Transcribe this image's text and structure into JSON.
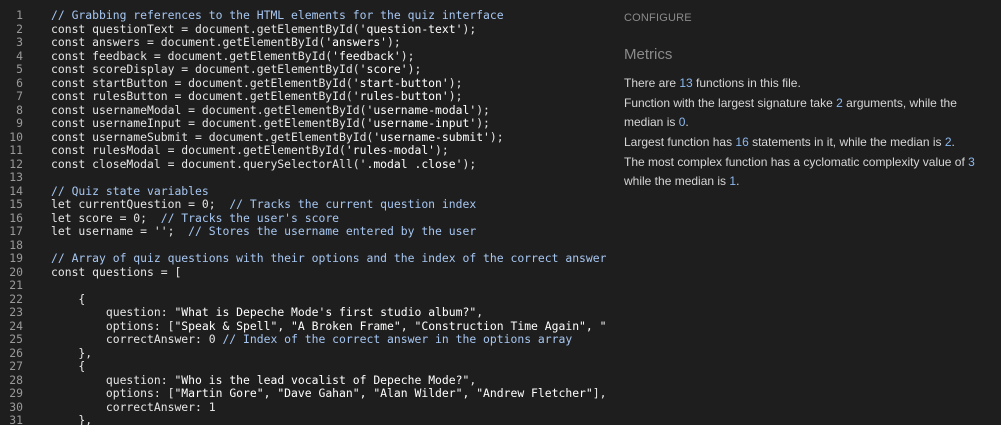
{
  "editor": {
    "lines": [
      {
        "n": "1",
        "tokens": [
          {
            "t": "// Grabbing references to the HTML elements for the quiz interface",
            "c": "cm"
          }
        ]
      },
      {
        "n": "2",
        "tokens": [
          {
            "t": "const questionText = document.getElementById("
          },
          {
            "t": "'question-text'",
            "c": "str"
          },
          {
            "t": ");"
          }
        ]
      },
      {
        "n": "3",
        "tokens": [
          {
            "t": "const answers = document.getElementById("
          },
          {
            "t": "'answers'",
            "c": "str"
          },
          {
            "t": ");"
          }
        ]
      },
      {
        "n": "4",
        "tokens": [
          {
            "t": "const feedback = document.getElementById("
          },
          {
            "t": "'feedback'",
            "c": "str"
          },
          {
            "t": ");"
          }
        ]
      },
      {
        "n": "5",
        "tokens": [
          {
            "t": "const scoreDisplay = document.getElementById("
          },
          {
            "t": "'score'",
            "c": "str"
          },
          {
            "t": ");"
          }
        ]
      },
      {
        "n": "6",
        "tokens": [
          {
            "t": "const startButton = document.getElementById("
          },
          {
            "t": "'start-button'",
            "c": "str"
          },
          {
            "t": ");"
          }
        ]
      },
      {
        "n": "7",
        "tokens": [
          {
            "t": "const rulesButton = document.getElementById("
          },
          {
            "t": "'rules-button'",
            "c": "str"
          },
          {
            "t": ");"
          }
        ]
      },
      {
        "n": "8",
        "tokens": [
          {
            "t": "const usernameModal = document.getElementById("
          },
          {
            "t": "'username-modal'",
            "c": "str"
          },
          {
            "t": ");"
          }
        ]
      },
      {
        "n": "9",
        "tokens": [
          {
            "t": "const usernameInput = document.getElementById("
          },
          {
            "t": "'username-input'",
            "c": "str"
          },
          {
            "t": ");"
          }
        ]
      },
      {
        "n": "10",
        "tokens": [
          {
            "t": "const usernameSubmit = document.getElementById("
          },
          {
            "t": "'username-submit'",
            "c": "str"
          },
          {
            "t": ");"
          }
        ]
      },
      {
        "n": "11",
        "tokens": [
          {
            "t": "const rulesModal = document.getElementById("
          },
          {
            "t": "'rules-modal'",
            "c": "str"
          },
          {
            "t": ");"
          }
        ]
      },
      {
        "n": "12",
        "tokens": [
          {
            "t": "const closeModal = document.querySelectorAll("
          },
          {
            "t": "'.modal .close'",
            "c": "str"
          },
          {
            "t": ");"
          }
        ]
      },
      {
        "n": "13",
        "tokens": []
      },
      {
        "n": "14",
        "tokens": [
          {
            "t": "// Quiz state variables",
            "c": "cm"
          }
        ]
      },
      {
        "n": "15",
        "tokens": [
          {
            "t": "let currentQuestion = 0;  "
          },
          {
            "t": "// Tracks the current question index",
            "c": "cm"
          }
        ]
      },
      {
        "n": "16",
        "tokens": [
          {
            "t": "let score = 0;  "
          },
          {
            "t": "// Tracks the user's score",
            "c": "cm"
          }
        ]
      },
      {
        "n": "17",
        "tokens": [
          {
            "t": "let username = '';  "
          },
          {
            "t": "// Stores the username entered by the user",
            "c": "cm"
          }
        ]
      },
      {
        "n": "18",
        "tokens": []
      },
      {
        "n": "19",
        "tokens": [
          {
            "t": "// Array of quiz questions with their options and the index of the correct answer",
            "c": "cm"
          }
        ]
      },
      {
        "n": "20",
        "tokens": [
          {
            "t": "const questions = ["
          }
        ]
      },
      {
        "n": "21",
        "tokens": []
      },
      {
        "n": "22",
        "tokens": [
          {
            "t": "    {"
          }
        ]
      },
      {
        "n": "23",
        "tokens": [
          {
            "t": "        question: "
          },
          {
            "t": "\"What is Depeche Mode's first studio album?\"",
            "c": "str"
          },
          {
            "t": ","
          }
        ]
      },
      {
        "n": "24",
        "tokens": [
          {
            "t": "        options: ["
          },
          {
            "t": "\"Speak & Spell\", \"A Broken Frame\", \"Construction Time Again\", \"B",
            "c": "str"
          }
        ]
      },
      {
        "n": "25",
        "tokens": [
          {
            "t": "        correctAnswer: 0 "
          },
          {
            "t": "// Index of the correct answer in the options array",
            "c": "cm"
          }
        ]
      },
      {
        "n": "26",
        "tokens": [
          {
            "t": "    },"
          }
        ]
      },
      {
        "n": "27",
        "tokens": [
          {
            "t": "    {"
          }
        ]
      },
      {
        "n": "28",
        "tokens": [
          {
            "t": "        question: "
          },
          {
            "t": "\"Who is the lead vocalist of Depeche Mode?\"",
            "c": "str"
          },
          {
            "t": ","
          }
        ]
      },
      {
        "n": "29",
        "tokens": [
          {
            "t": "        options: ["
          },
          {
            "t": "\"Martin Gore\", \"Dave Gahan\", \"Alan Wilder\", \"Andrew Fletcher\"",
            "c": "str"
          },
          {
            "t": "],"
          }
        ]
      },
      {
        "n": "30",
        "tokens": [
          {
            "t": "        correctAnswer: 1"
          }
        ]
      },
      {
        "n": "31",
        "tokens": [
          {
            "t": "    },"
          }
        ]
      }
    ]
  },
  "panel": {
    "configure_label": "CONFIGURE",
    "metrics_title": "Metrics",
    "para1": {
      "pre": "There are ",
      "n1": "13",
      "post": " functions in this file."
    },
    "para2": {
      "pre": "Function with the largest signature take ",
      "n1": "2",
      "mid": " arguments, while the median is ",
      "n2": "0",
      "post": "."
    },
    "para3": {
      "pre": "Largest function has ",
      "n1": "16",
      "mid": " statements in it, while the median is ",
      "n2": "2",
      "post": "."
    },
    "para4": {
      "pre": "The most complex function has a cyclomatic complexity value of ",
      "n1": "3",
      "mid": " while the median is ",
      "n2": "1",
      "post": "."
    }
  },
  "colors": {
    "background": "#1e1e1e",
    "comment": "#a7c7f2",
    "number_highlight": "#8db8ee",
    "muted_heading": "#8a8a8a"
  }
}
